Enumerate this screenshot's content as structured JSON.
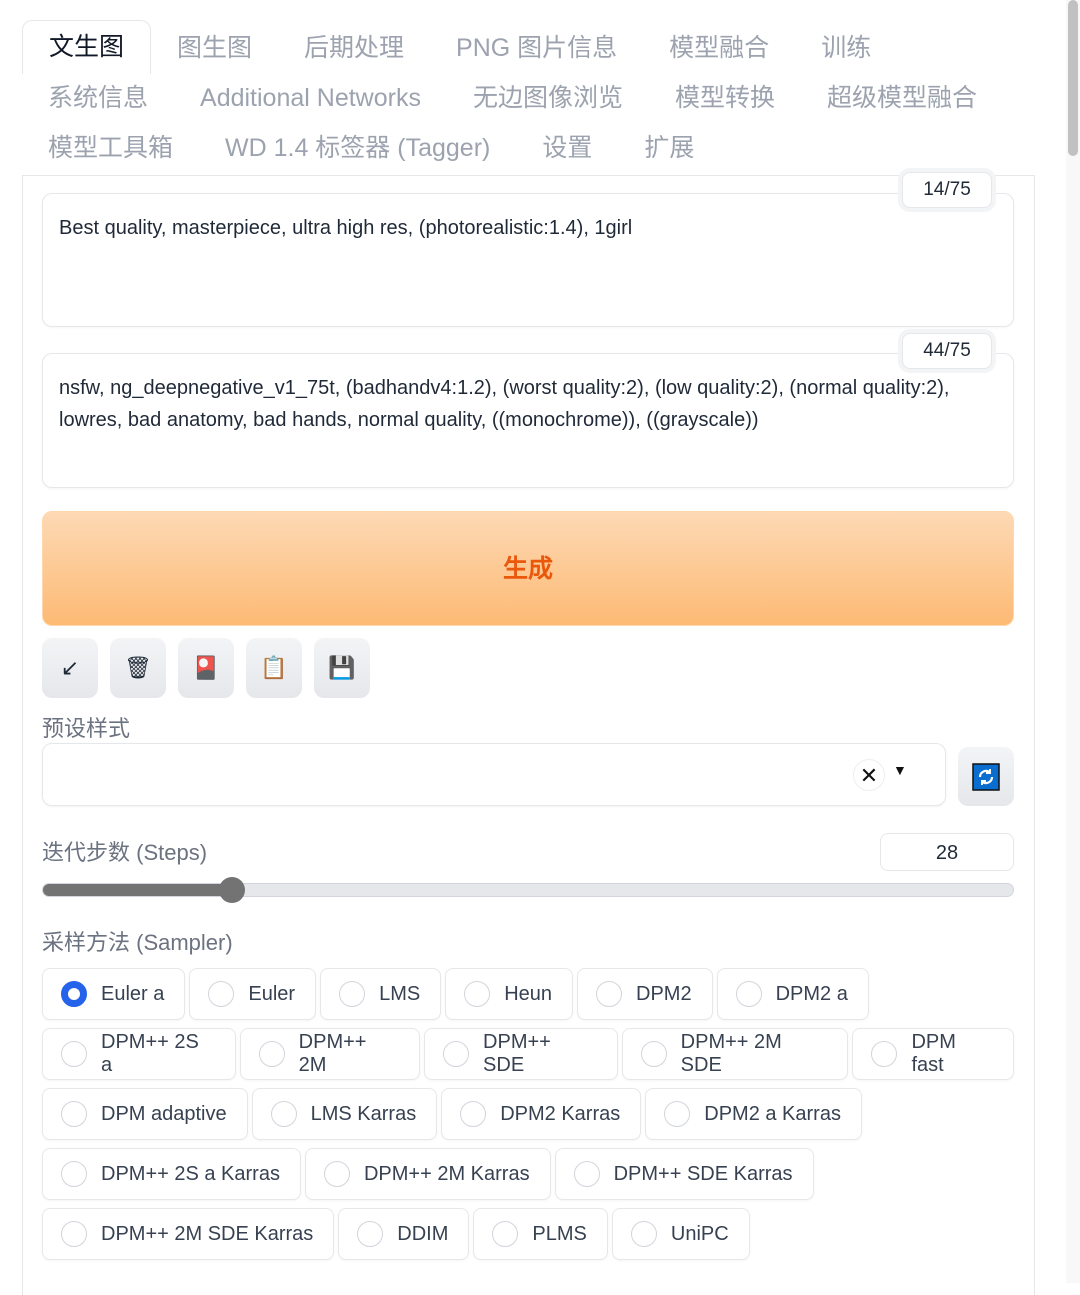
{
  "tabs": [
    [
      "文生图",
      "图生图",
      "后期处理",
      "PNG 图片信息",
      "模型融合",
      "训练"
    ],
    [
      "系统信息",
      "Additional Networks",
      "无边图像浏览",
      "模型转换",
      "超级模型融合"
    ],
    [
      "模型工具箱",
      "WD 1.4 标签器 (Tagger)",
      "设置",
      "扩展"
    ]
  ],
  "active_tab": "文生图",
  "prompt": {
    "value": "Best quality, masterpiece, ultra high res, (photorealistic:1.4), 1girl",
    "counter": "14/75"
  },
  "negative_prompt": {
    "value": "nsfw, ng_deepnegative_v1_75t, (badhandv4:1.2), (worst quality:2), (low quality:2), (normal quality:2), lowres, bad anatomy, bad hands, normal quality, ((monochrome)), ((grayscale))",
    "counter": "44/75"
  },
  "generate_label": "生成",
  "tools": [
    {
      "icon": "arrow-down-left-icon",
      "glyph": "↙"
    },
    {
      "icon": "trash-icon",
      "glyph": "🗑"
    },
    {
      "icon": "red-card-icon",
      "glyph": "🎴"
    },
    {
      "icon": "clipboard-icon",
      "glyph": "📋"
    },
    {
      "icon": "save-icon",
      "glyph": "💾"
    }
  ],
  "styles": {
    "label": "预设样式",
    "value": "",
    "clear_glyph": "✕",
    "caret_glyph": "▼"
  },
  "steps": {
    "label": "迭代步数 (Steps)",
    "value": "28",
    "min": 1,
    "max": 150
  },
  "sampler": {
    "label": "采样方法 (Sampler)",
    "selected": "Euler a",
    "rows": [
      [
        "Euler a",
        "Euler",
        "LMS",
        "Heun",
        "DPM2",
        "DPM2 a"
      ],
      [
        "DPM++ 2S a",
        "DPM++ 2M",
        "DPM++ SDE",
        "DPM++ 2M SDE",
        "DPM fast"
      ],
      [
        "DPM adaptive",
        "LMS Karras",
        "DPM2 Karras",
        "DPM2 a Karras"
      ],
      [
        "DPM++ 2S a Karras",
        "DPM++ 2M Karras",
        "DPM++ SDE Karras"
      ],
      [
        "DPM++ 2M SDE Karras",
        "DDIM",
        "PLMS",
        "UniPC"
      ]
    ]
  },
  "colors": {
    "accent": "#2563eb",
    "generate_text": "#ea580c",
    "generate_bg": "#fdba74"
  }
}
